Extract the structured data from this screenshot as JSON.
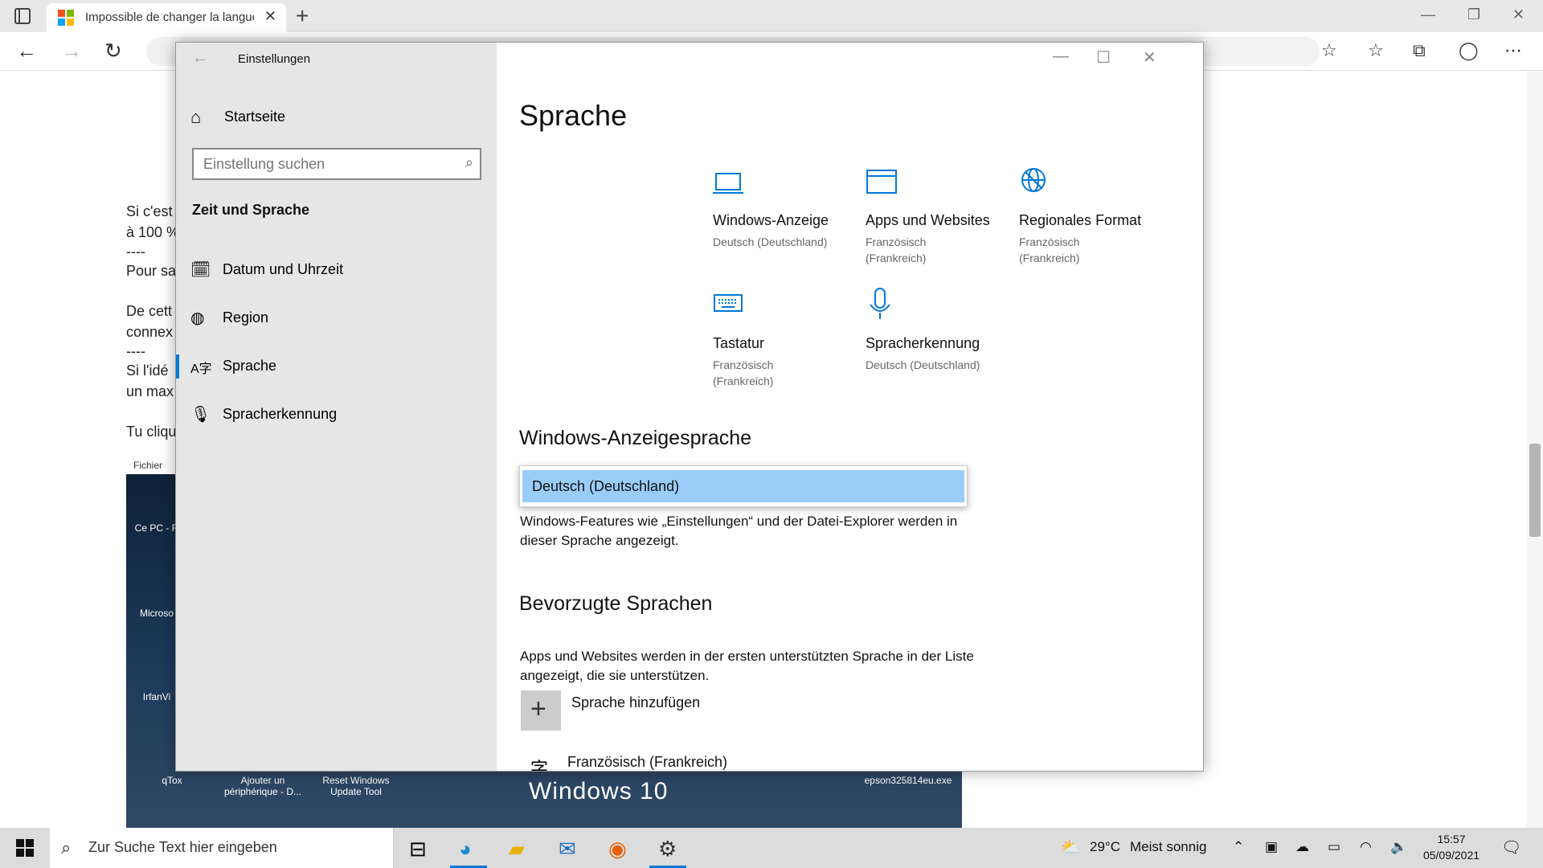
{
  "browser": {
    "tab_title": "Impossible de changer la langue",
    "new_tab": "+",
    "close_tab": "✕"
  },
  "page": {
    "lines": [
      "Si c'est",
      "à 100 %",
      "----",
      "Pour sa",
      "De cett",
      "connex",
      "----",
      "Si l'idé",
      "un max",
      "Tu cliqu"
    ],
    "fichier": "Fichier",
    "desktop_labels": [
      "Ce PC - R",
      "Microso",
      "IrfanVi",
      "qTox",
      "Ajouter un périphérique - D...",
      "Reset Windows Update Tool",
      "epson325814eu.exe"
    ],
    "banner": "Windows 10"
  },
  "settings": {
    "window_title": "Einstellungen",
    "home_label": "Startseite",
    "search_placeholder": "Einstellung suchen",
    "section_title": "Zeit und Sprache",
    "nav": [
      {
        "label": "Datum und Uhrzeit",
        "icon": "calendar-clock-icon"
      },
      {
        "label": "Region",
        "icon": "globe-icon"
      },
      {
        "label": "Sprache",
        "icon": "language-icon"
      },
      {
        "label": "Spracherkennung",
        "icon": "microphone-icon"
      }
    ],
    "selected_nav": "Sprache",
    "page_title": "Sprache",
    "tiles": [
      {
        "title": "Windows-Anzeige",
        "subtitle": "Deutsch (Deutschland)",
        "icon": "laptop-icon"
      },
      {
        "title": "Apps und Websites",
        "subtitle": "Französisch (Frankreich)",
        "icon": "window-icon"
      },
      {
        "title": "Regionales Format",
        "subtitle": "Französisch (Frankreich)",
        "icon": "globe-icon"
      },
      {
        "title": "Tastatur",
        "subtitle": "Französisch (Frankreich)",
        "icon": "keyboard-icon"
      },
      {
        "title": "Spracherkennung",
        "subtitle": "Deutsch (Deutschland)",
        "icon": "microphone-icon"
      }
    ],
    "display_lang_heading": "Windows-Anzeigesprache",
    "display_lang_selected": "Deutsch (Deutschland)",
    "display_lang_desc": "Windows-Features wie „Einstellungen“ und der Datei-Explorer werden in dieser Sprache angezeigt.",
    "preferred_heading": "Bevorzugte Sprachen",
    "preferred_desc": "Apps und Websites werden in der ersten unterstützten Sprache in der Liste angezeigt, die sie unterstützen.",
    "add_language": "Sprache hinzufügen",
    "language_entry": "Französisch (Frankreich)"
  },
  "taskbar": {
    "search_placeholder": "Zur Suche Text hier eingeben",
    "weather_temp": "29°C",
    "weather_text": "Meist sonnig",
    "time": "15:57",
    "date": "05/09/2021"
  },
  "colors": {
    "accent": "#0078d7",
    "dropdown_highlight": "#99cdf8",
    "sidebar_bg": "#e6e6e6"
  }
}
